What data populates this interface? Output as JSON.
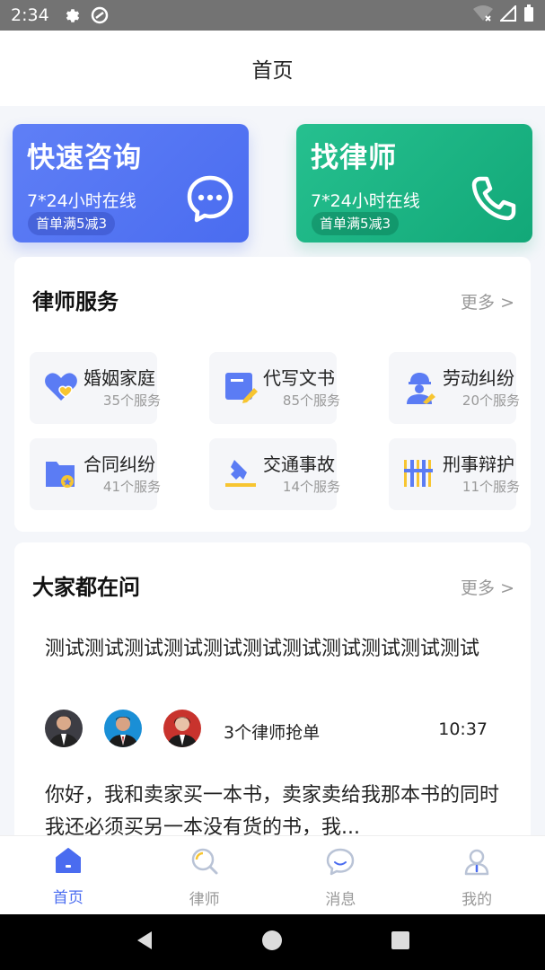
{
  "statusbar": {
    "time": "2:34"
  },
  "header": {
    "title": "首页"
  },
  "quick_cards": [
    {
      "title": "快速咨询",
      "subtitle": "7*24小时在线",
      "badge": "首单满5减3",
      "icon": "chat-bubble-icon",
      "color": "#4a6cf0"
    },
    {
      "title": "找律师",
      "subtitle": "7*24小时在线",
      "badge": "首单满5减3",
      "icon": "phone-icon",
      "color": "#12a878"
    }
  ],
  "lawyer_services": {
    "title": "律师服务",
    "more": "更多 >",
    "items": [
      {
        "name": "婚姻家庭",
        "count": "35个服务",
        "icon": "heart-icon"
      },
      {
        "name": "代写文书",
        "count": "85个服务",
        "icon": "document-pen-icon"
      },
      {
        "name": "劳动纠纷",
        "count": "20个服务",
        "icon": "worker-icon"
      },
      {
        "name": "合同纠纷",
        "count": "41个服务",
        "icon": "contract-folder-icon"
      },
      {
        "name": "交通事故",
        "count": "14个服务",
        "icon": "traffic-accident-icon"
      },
      {
        "name": "刑事辩护",
        "count": "11个服务",
        "icon": "prison-bars-icon"
      }
    ]
  },
  "questions": {
    "title": "大家都在问",
    "more": "更多 >",
    "item": {
      "title": "测试测试测试测试测试测试测试测试测试测试测试",
      "lawyers_text": "3个律师抢单",
      "time": "10:37",
      "body": "你好，我和卖家买一本书，卖家卖给我那本书的同时我还必须买另一本没有货的书，我..."
    }
  },
  "tabbar": {
    "tabs": [
      {
        "label": "首页",
        "icon": "home-icon",
        "active": true
      },
      {
        "label": "律师",
        "icon": "lawyer-search-icon",
        "active": false
      },
      {
        "label": "消息",
        "icon": "message-icon",
        "active": false
      },
      {
        "label": "我的",
        "icon": "profile-icon",
        "active": false
      }
    ]
  },
  "colors": {
    "accent": "#4a6cf0",
    "green": "#12a878",
    "background": "#f4f6fa"
  }
}
